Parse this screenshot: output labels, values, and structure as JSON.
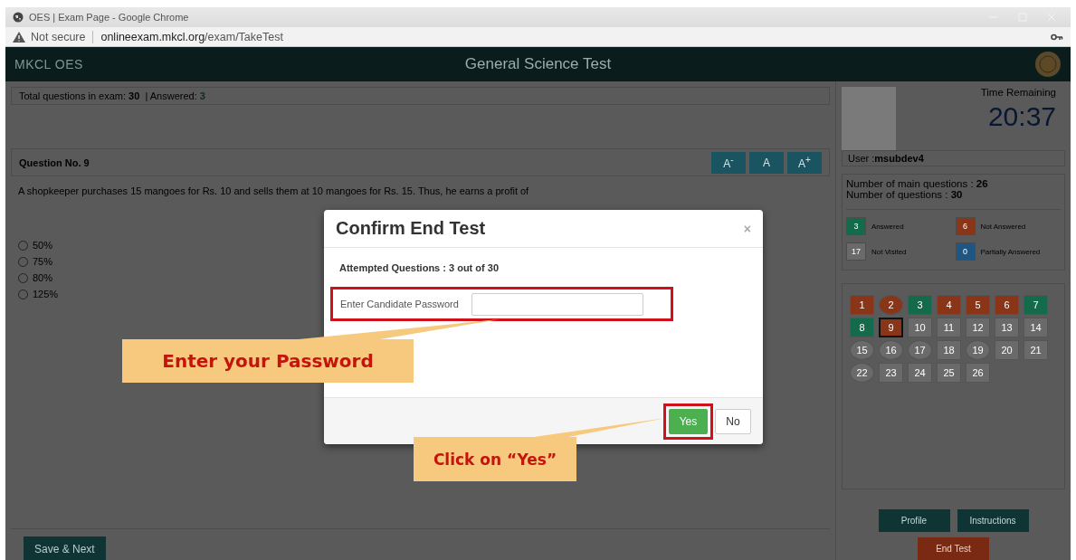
{
  "browser": {
    "title": "OES | Exam Page - Google Chrome",
    "security": "Not secure",
    "url_host": "onlineexam.mkcl.org",
    "url_path": "/exam/TakeTest"
  },
  "header": {
    "logo": "MKCL OES",
    "title": "General Science Test"
  },
  "summary": {
    "total_label": "Total questions in exam:",
    "total": "30",
    "answered_label": "| Answered:",
    "answered": "3"
  },
  "question": {
    "heading": "Question No. 9",
    "font_buttons": [
      "A$^{-}$",
      "A",
      "A$^{+}$"
    ],
    "text": "A shopkeeper purchases 15 mangoes for Rs. 10 and sells them at 10 mangoes for Rs. 15. Thus, he earns a profit of",
    "options": [
      {
        "label": "50%",
        "selected": false
      },
      {
        "label": "75%",
        "selected": false
      },
      {
        "label": "80%",
        "selected": false
      },
      {
        "label": "125%",
        "selected": false
      }
    ]
  },
  "save_button": "Save & Next",
  "candidate": {
    "time_label": "Time Remaining",
    "time": "20:37",
    "user_label": "User :",
    "user": "msubdev4",
    "main_questions_label": "Number of main questions :",
    "main_questions": "26",
    "questions_label": "Number of questions :",
    "questions": "30"
  },
  "legend": [
    {
      "count": "3",
      "label": "Answered",
      "color": "#146b4c"
    },
    {
      "count": "6",
      "label": "Not Answered",
      "color": "#8a3418"
    },
    {
      "count": "17",
      "label": "Not Visited",
      "color": "#6a6a6a"
    },
    {
      "count": "0",
      "label": "Partially Answered",
      "color": "#1d5683"
    }
  ],
  "palette": [
    {
      "label": "1",
      "color": "#8a3418",
      "round": false,
      "selected": false
    },
    {
      "label": "2",
      "color": "#8a3418",
      "round": true,
      "selected": false
    },
    {
      "label": "3",
      "color": "#146b4c",
      "round": false,
      "selected": false
    },
    {
      "label": "4",
      "color": "#8a3418",
      "round": false,
      "selected": false
    },
    {
      "label": "5",
      "color": "#8a3418",
      "round": false,
      "selected": false
    },
    {
      "label": "6",
      "color": "#8a3418",
      "round": false,
      "selected": false
    },
    {
      "label": "7",
      "color": "#146b4c",
      "round": false,
      "selected": false
    },
    {
      "label": "8",
      "color": "#146b4c",
      "round": false,
      "selected": false
    },
    {
      "label": "9",
      "color": "#8a3418",
      "round": false,
      "selected": true
    },
    {
      "label": "10",
      "color": "#6a6a6a",
      "round": false,
      "selected": false
    },
    {
      "label": "11",
      "color": "#6a6a6a",
      "round": false,
      "selected": false
    },
    {
      "label": "12",
      "color": "#6a6a6a",
      "round": false,
      "selected": false
    },
    {
      "label": "13",
      "color": "#6a6a6a",
      "round": false,
      "selected": false
    },
    {
      "label": "14",
      "color": "#6a6a6a",
      "round": false,
      "selected": false
    },
    {
      "label": "15",
      "color": "#6a6a6a",
      "round": true,
      "selected": false
    },
    {
      "label": "16",
      "color": "#6a6a6a",
      "round": true,
      "selected": false
    },
    {
      "label": "17",
      "color": "#6a6a6a",
      "round": true,
      "selected": false
    },
    {
      "label": "18",
      "color": "#6a6a6a",
      "round": false,
      "selected": false
    },
    {
      "label": "19",
      "color": "#6a6a6a",
      "round": true,
      "selected": false
    },
    {
      "label": "20",
      "color": "#6a6a6a",
      "round": false,
      "selected": false
    },
    {
      "label": "21",
      "color": "#6a6a6a",
      "round": false,
      "selected": false
    },
    {
      "label": "22",
      "color": "#6a6a6a",
      "round": true,
      "selected": false
    },
    {
      "label": "23",
      "color": "#6a6a6a",
      "round": false,
      "selected": false
    },
    {
      "label": "24",
      "color": "#6a6a6a",
      "round": false,
      "selected": false
    },
    {
      "label": "25",
      "color": "#6a6a6a",
      "round": false,
      "selected": false
    },
    {
      "label": "26",
      "color": "#6a6a6a",
      "round": false,
      "selected": false
    }
  ],
  "side_buttons": [
    {
      "label": "Profile",
      "kind": "primary"
    },
    {
      "label": "Instructions",
      "kind": "primary"
    },
    {
      "label": "End Test",
      "kind": "danger"
    }
  ],
  "dialog": {
    "title": "Confirm End Test",
    "close": "×",
    "attempted": "Attempted Questions : 3 out of 30",
    "password_label": "Enter Candidate Password",
    "yes": "Yes",
    "no": "No"
  },
  "annotations": [
    {
      "text": "Enter your Password",
      "kind": "field"
    },
    {
      "text": "Click on “Yes”",
      "kind": "button"
    }
  ]
}
